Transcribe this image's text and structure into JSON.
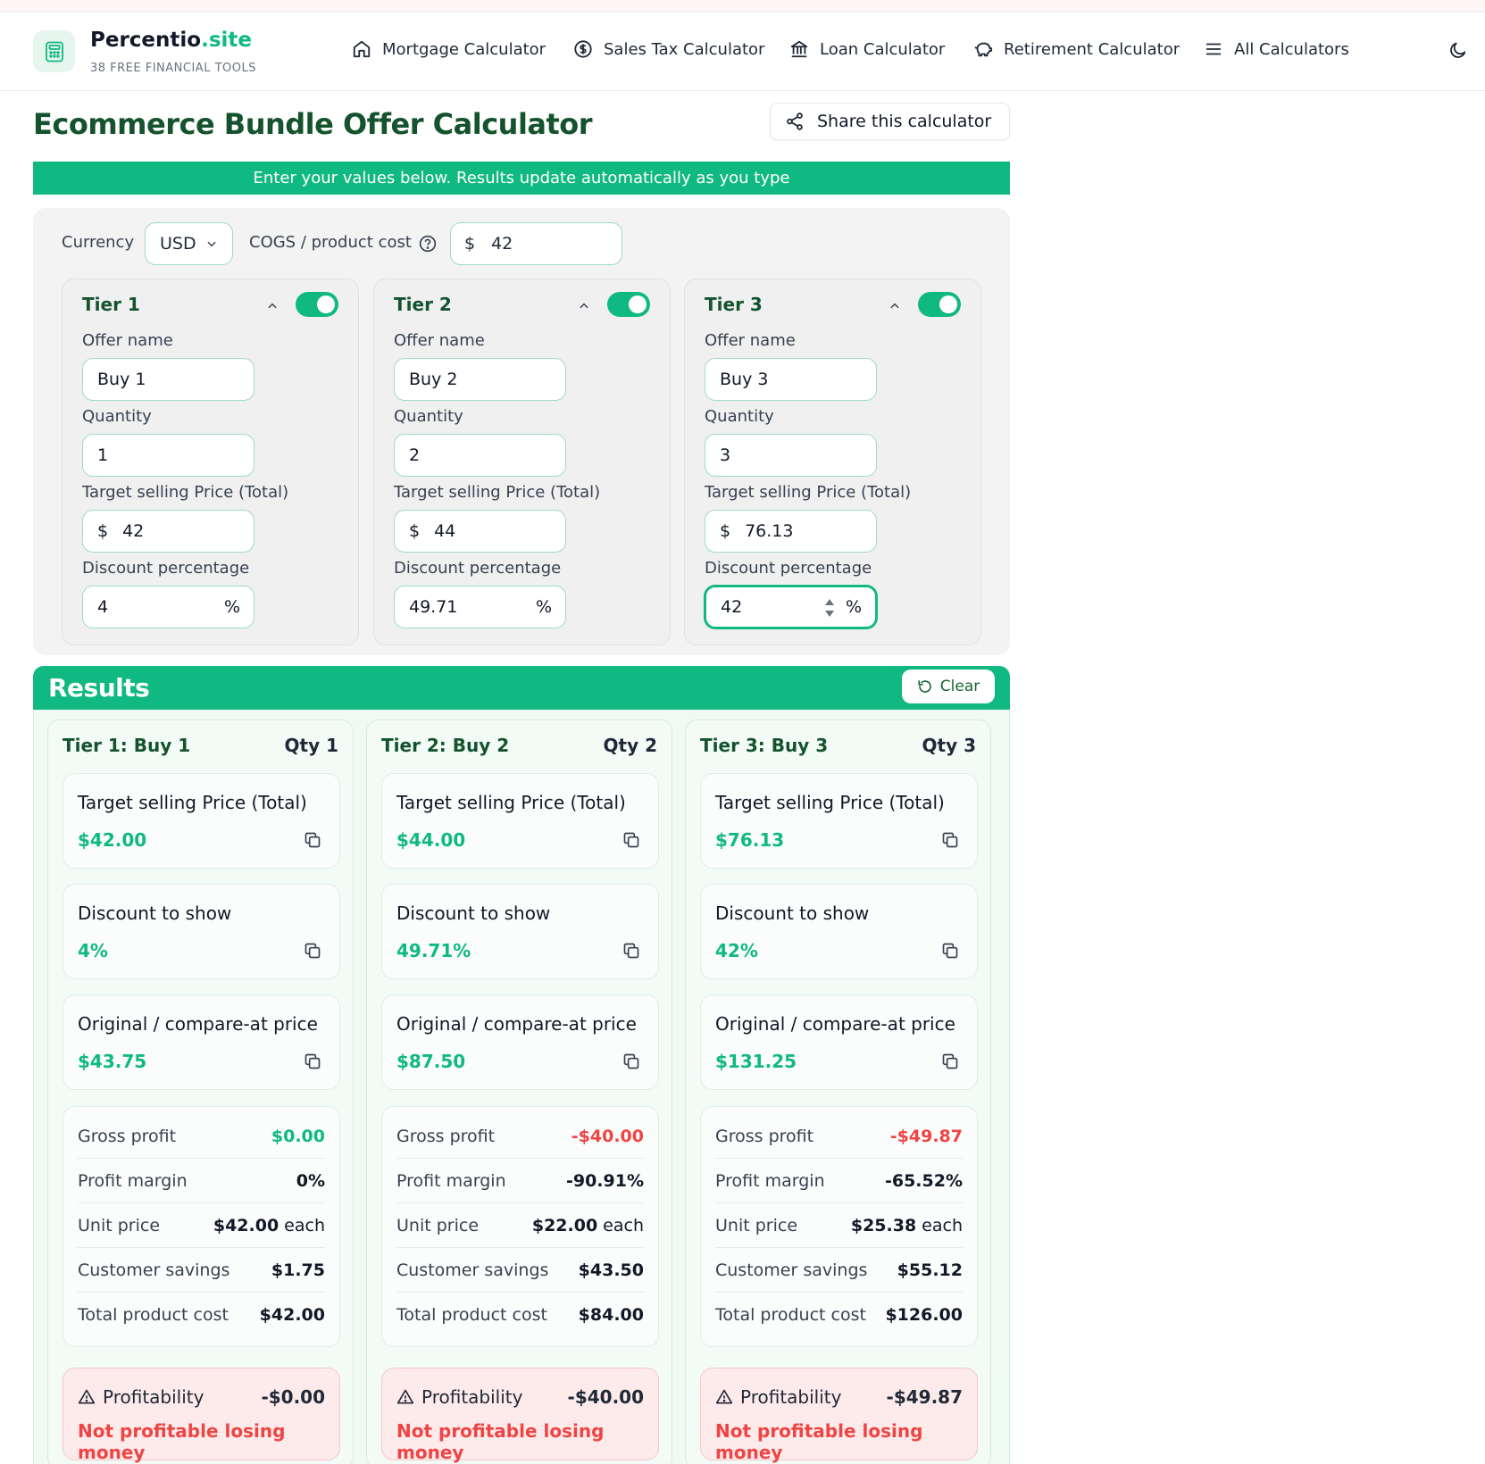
{
  "brand": {
    "name_main": "Percentio",
    "name_suffix": ".site",
    "subtitle": "38 FREE FINANCIAL TOOLS"
  },
  "nav": [
    {
      "label": "Mortgage Calculator",
      "icon": "home-icon"
    },
    {
      "label": "Sales Tax Calculator",
      "icon": "dollar-circle-icon"
    },
    {
      "label": "Loan Calculator",
      "icon": "bank-icon"
    },
    {
      "label": "Retirement Calculator",
      "icon": "piggy-bank-icon"
    },
    {
      "label": "All Calculators",
      "icon": "menu-icon"
    }
  ],
  "page": {
    "title": "Ecommerce Bundle Offer Calculator",
    "share_label": "Share this calculator",
    "banner": "Enter your values below. Results update automatically as you type"
  },
  "inputs": {
    "currency_label": "Currency",
    "currency_value": "USD",
    "cogs_label": "COGS / product cost",
    "currency_symbol": "$",
    "cogs_value": "42",
    "offer_name_label": "Offer name",
    "quantity_label": "Quantity",
    "price_label": "Target selling Price (Total)",
    "discount_label": "Discount percentage",
    "percent_symbol": "%",
    "tiers": [
      {
        "title": "Tier 1",
        "enabled": true,
        "offer_name": "Buy 1",
        "quantity": "1",
        "price": "42",
        "discount": "4"
      },
      {
        "title": "Tier 2",
        "enabled": true,
        "offer_name": "Buy 2",
        "quantity": "2",
        "price": "44",
        "discount": "49.71"
      },
      {
        "title": "Tier 3",
        "enabled": true,
        "offer_name": "Buy 3",
        "quantity": "3",
        "price": "76.13",
        "discount": "42"
      }
    ]
  },
  "results": {
    "title": "Results",
    "clear_label": "Clear",
    "labels": {
      "price": "Target selling Price (Total)",
      "discount": "Discount to show",
      "original": "Original / compare-at price",
      "gross_profit": "Gross profit",
      "profit_margin": "Profit margin",
      "unit_price": "Unit price",
      "each": "each",
      "customer_savings": "Customer savings",
      "total_cost": "Total product cost",
      "profitability": "Profitability"
    },
    "tiers": [
      {
        "header": "Tier 1: Buy 1",
        "qty": "Qty 1",
        "price": "$42.00",
        "discount": "4%",
        "original": "$43.75",
        "gross_profit": "$0.00",
        "gross_profit_status": "green",
        "profit_margin": "0%",
        "unit_price": "$42.00",
        "customer_savings": "$1.75",
        "total_cost": "$42.00",
        "profitability": "-$0.00",
        "profit_message": "Not profitable losing money"
      },
      {
        "header": "Tier 2: Buy 2",
        "qty": "Qty 2",
        "price": "$44.00",
        "discount": "49.71%",
        "original": "$87.50",
        "gross_profit": "-$40.00",
        "gross_profit_status": "red",
        "profit_margin": "-90.91%",
        "unit_price": "$22.00",
        "customer_savings": "$43.50",
        "total_cost": "$84.00",
        "profitability": "-$40.00",
        "profit_message": "Not profitable losing money"
      },
      {
        "header": "Tier 3: Buy 3",
        "qty": "Qty 3",
        "price": "$76.13",
        "discount": "42%",
        "original": "$131.25",
        "gross_profit": "-$49.87",
        "gross_profit_status": "red",
        "profit_margin": "-65.52%",
        "unit_price": "$25.38",
        "customer_savings": "$55.12",
        "total_cost": "$126.00",
        "profitability": "-$49.87",
        "profit_message": "Not profitable losing money"
      }
    ]
  },
  "colors": {
    "accent": "#10b981",
    "title": "#14532d",
    "negative": "#ef4444"
  }
}
